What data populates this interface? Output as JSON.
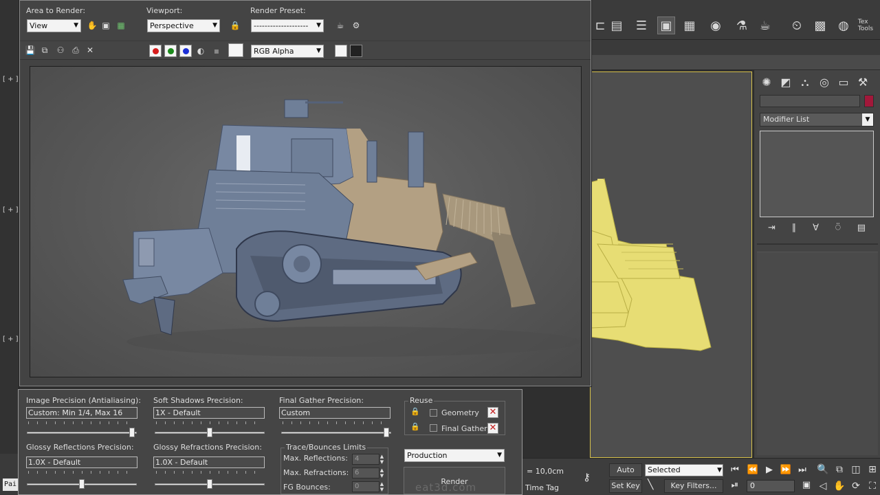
{
  "frame_window": {
    "area_label": "Area to Render:",
    "area_value": "View",
    "viewport_label": "Viewport:",
    "viewport_value": "Perspective",
    "preset_label": "Render Preset:",
    "preset_value": "--------------------",
    "channel_value": "RGB Alpha"
  },
  "settings": {
    "image_precision_label": "Image Precision (Antialiasing):",
    "image_precision_value": "Custom: Min 1/4, Max 16",
    "soft_shadows_label": "Soft Shadows Precision:",
    "soft_shadows_value": "1X - Default",
    "final_gather_label": "Final Gather Precision:",
    "final_gather_value": "Custom",
    "glossy_refl_label": "Glossy Reflections Precision:",
    "glossy_refl_value": "1.0X - Default",
    "glossy_refr_label": "Glossy Refractions Precision:",
    "glossy_refr_value": "1.0X - Default",
    "reuse_title": "Reuse",
    "reuse_geometry": "Geometry",
    "reuse_final_gather": "Final Gather",
    "trace_title": "Trace/Bounces Limits",
    "max_reflections_label": "Max. Reflections:",
    "max_reflections_value": "4",
    "max_refractions_label": "Max. Refractions:",
    "max_refractions_value": "6",
    "fg_bounces_label": "FG Bounces:",
    "fg_bounces_value": "0",
    "mode_value": "Production",
    "render_button": "Render"
  },
  "sliders": {
    "image_precision": 0.98,
    "soft_shadows": 0.5,
    "final_gather": 0.98,
    "glossy_refl": 0.5,
    "glossy_refr": 0.5
  },
  "command_panel": {
    "modifier_list": "Modifier List",
    "color_swatch": "#a2183a"
  },
  "bottom_bar": {
    "grid_value": "= 10,0cm",
    "time_tag": "Time Tag",
    "auto_key": "Auto Key",
    "set_key": "Set Key",
    "selected_value": "Selected",
    "key_filters": "Key Filters...",
    "frame_value": "0"
  },
  "left_strip": {
    "vp_label_1": "[ + ]",
    "vp_label_2": "[ + ]",
    "vp_label_3": "[ + ]",
    "tab_pai": "Pai"
  },
  "watermark": "eat3d.com",
  "colors": {
    "dozer_blue": "#6f7f98",
    "dozer_tan": "#b3a083",
    "viewport_yellow": "#e7dd74",
    "selection_border": "#d8c24b"
  }
}
